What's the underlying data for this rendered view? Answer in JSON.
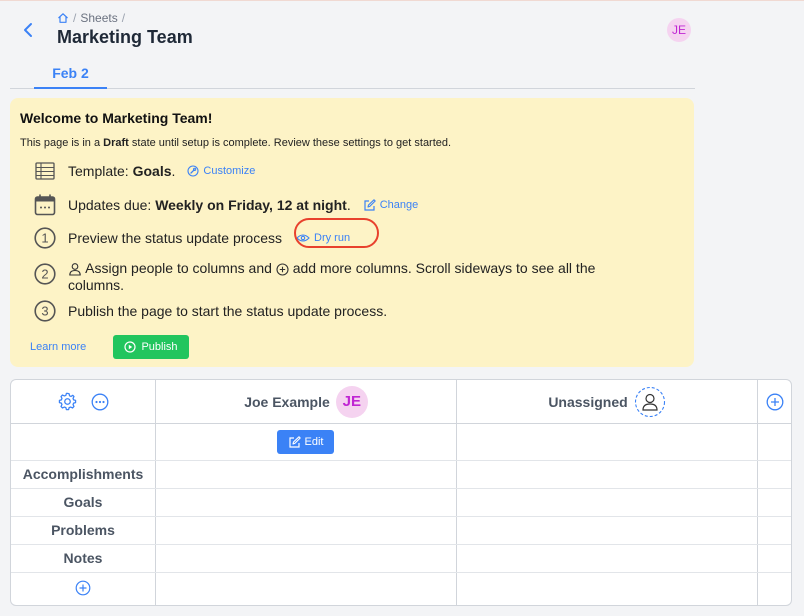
{
  "header": {
    "breadcrumb": {
      "sheets": "Sheets",
      "separator": "/"
    },
    "title": "Marketing Team",
    "user_initials": "JE"
  },
  "tabs": [
    {
      "label": "Feb 2",
      "active": true
    }
  ],
  "banner": {
    "title": "Welcome to Marketing Team!",
    "subtitle": {
      "prefix": "This page is in a",
      "state": "Draft",
      "suffix": "state until setup is complete. Review these settings to get started."
    },
    "template": {
      "label": "Template:",
      "value": "Goals",
      "punct": ".",
      "link": "Customize"
    },
    "updates": {
      "label": "Updates due:",
      "value": "Weekly on Friday, 12 at night",
      "punct": ".",
      "link": "Change"
    },
    "steps": [
      {
        "number": "1",
        "text": "Preview the status update process",
        "link": "Dry run"
      },
      {
        "number": "2",
        "text_a": "Assign people to columns and",
        "text_b": "add more columns. Scroll sideways to see all the",
        "text_c": "columns."
      },
      {
        "number": "3",
        "text": "Publish the page to start the status update process."
      }
    ],
    "learn_more": "Learn more",
    "publish": "Publish",
    "colors": {
      "background": "#fdf3c6",
      "accent": "#3b82f6",
      "publish": "#22c55e",
      "highlight": "#e8412d"
    }
  },
  "grid": {
    "columns": [
      {
        "name": "Joe Example",
        "initials": "JE"
      },
      {
        "name": "Unassigned"
      }
    ],
    "edit_label": "Edit",
    "rows": [
      "Accomplishments",
      "Goals",
      "Problems",
      "Notes"
    ],
    "icons": [
      "gear-icon",
      "more-icon",
      "add-column-icon",
      "add-row-icon",
      "user-icon",
      "edit-icon"
    ]
  }
}
